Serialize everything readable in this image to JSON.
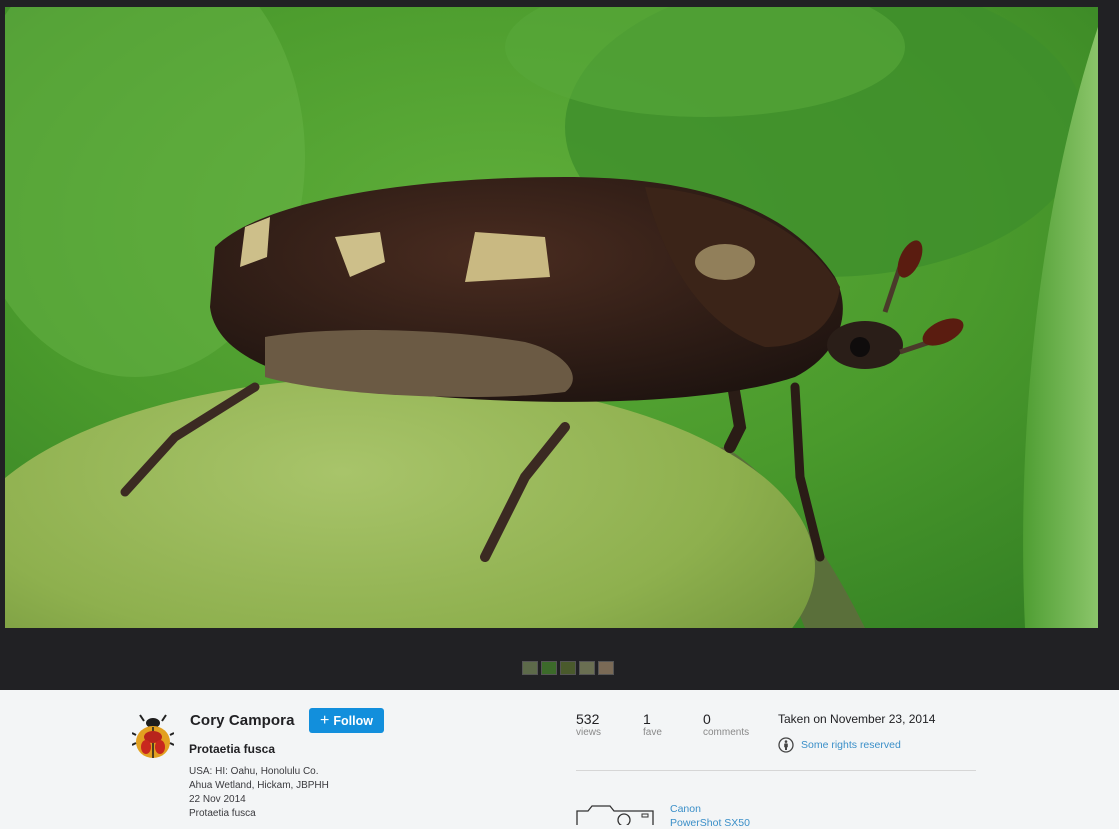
{
  "photo": {
    "subject": "beetle on green fruit"
  },
  "filmstrip": {
    "thumbnails": [
      "thumb-1",
      "thumb-2",
      "thumb-3",
      "thumb-4",
      "thumb-5"
    ]
  },
  "owner": {
    "name": "Cory Campora",
    "follow_label": "Follow"
  },
  "photo_title": "Protaetia fusca",
  "description": {
    "line1": "USA: HI: Oahu, Honolulu Co.",
    "line2": "Ahua Wetland, Hickam, JBPHH",
    "line3": "22 Nov 2014",
    "line4": "Protaetia fusca"
  },
  "stats": {
    "views": {
      "value": "532",
      "label": "views"
    },
    "faves": {
      "value": "1",
      "label": "fave"
    },
    "comments": {
      "value": "0",
      "label": "comments"
    }
  },
  "taken": "Taken on November 23, 2014",
  "license": "Some rights reserved",
  "camera": {
    "make": "Canon",
    "model": "PowerShot SX50"
  },
  "colors": {
    "stage_bg": "#212124",
    "page_bg": "#f3f5f6",
    "follow_button": "#128fdc",
    "link": "#3a8fc8"
  }
}
